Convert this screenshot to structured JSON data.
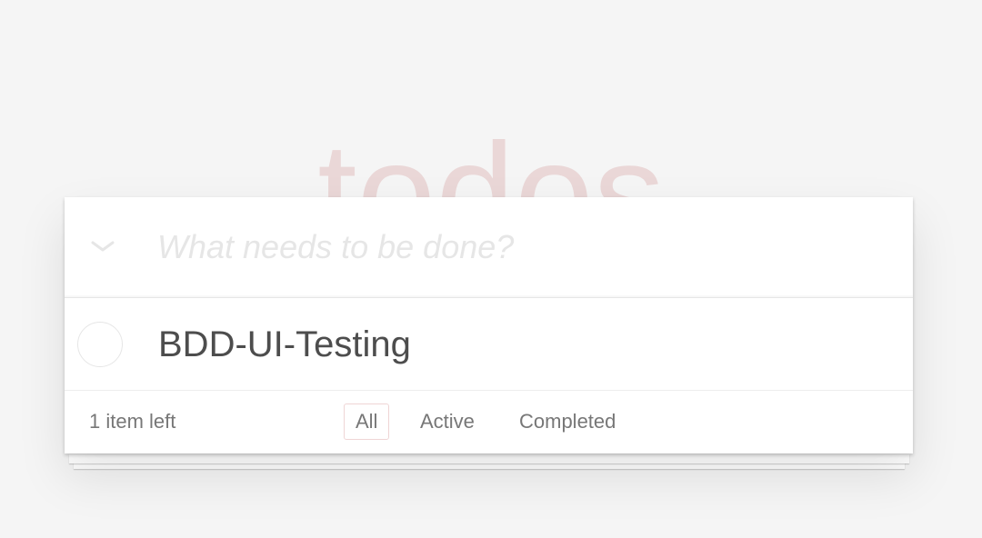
{
  "app": {
    "title": "todos"
  },
  "header": {
    "new_todo_placeholder": "What needs to be done?",
    "toggle_all_icon": "chevron-down-icon"
  },
  "todos": [
    {
      "label": "BDD-UI-Testing",
      "completed": false
    }
  ],
  "footer": {
    "count_text": "1 item left",
    "filters": [
      {
        "label": "All",
        "selected": true
      },
      {
        "label": "Active",
        "selected": false
      },
      {
        "label": "Completed",
        "selected": false
      }
    ]
  },
  "colors": {
    "background": "#f5f5f5",
    "title": "#eadada",
    "text": "#4d4d4d",
    "muted": "#777777",
    "selected_filter_border": "#efd5d5"
  }
}
